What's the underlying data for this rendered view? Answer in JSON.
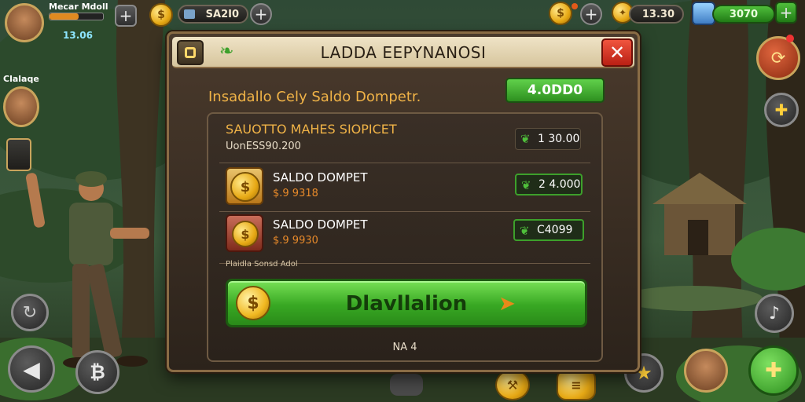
{
  "hud": {
    "player_name": "Mecar Mdoll",
    "player_level": "13.06",
    "currency1_value": "SA2I0",
    "currency2_value": "13.30",
    "currency3_value": "3070",
    "side_label": "Clalaqe"
  },
  "dialog": {
    "title": "LADDA EEPYNANOSI",
    "subtitle": "Insadallo Cely Saldo Dompetr.",
    "balance_badge": "4.0DD0",
    "section": {
      "title": "SAUOTTO MAHES SIOPICET",
      "subtitle": "UonESS90.200",
      "price": "1 30.00"
    },
    "items": [
      {
        "label": "SALDO DOMPET",
        "sub": "$.9 9318",
        "price": "2 4.000"
      },
      {
        "label": "SALDO DOMPET",
        "sub": "$.9 9930",
        "price": "C4099"
      }
    ],
    "footer_note": "Plaidla Sonsd Adol",
    "main_button": "Dlavllalion",
    "page_indicator": "NA 4"
  },
  "colors": {
    "accent_green": "#3da02b",
    "accent_orange": "#f0b347",
    "close_red": "#d6321e",
    "panel_brown": "#3a2f26"
  },
  "icons": [
    "avatar",
    "coin-icon",
    "ticket-icon",
    "gem-icon",
    "leaf-icon",
    "close-icon",
    "plus-icon",
    "back-arrow-icon",
    "pickaxe-icon",
    "star-icon",
    "map-icon"
  ]
}
